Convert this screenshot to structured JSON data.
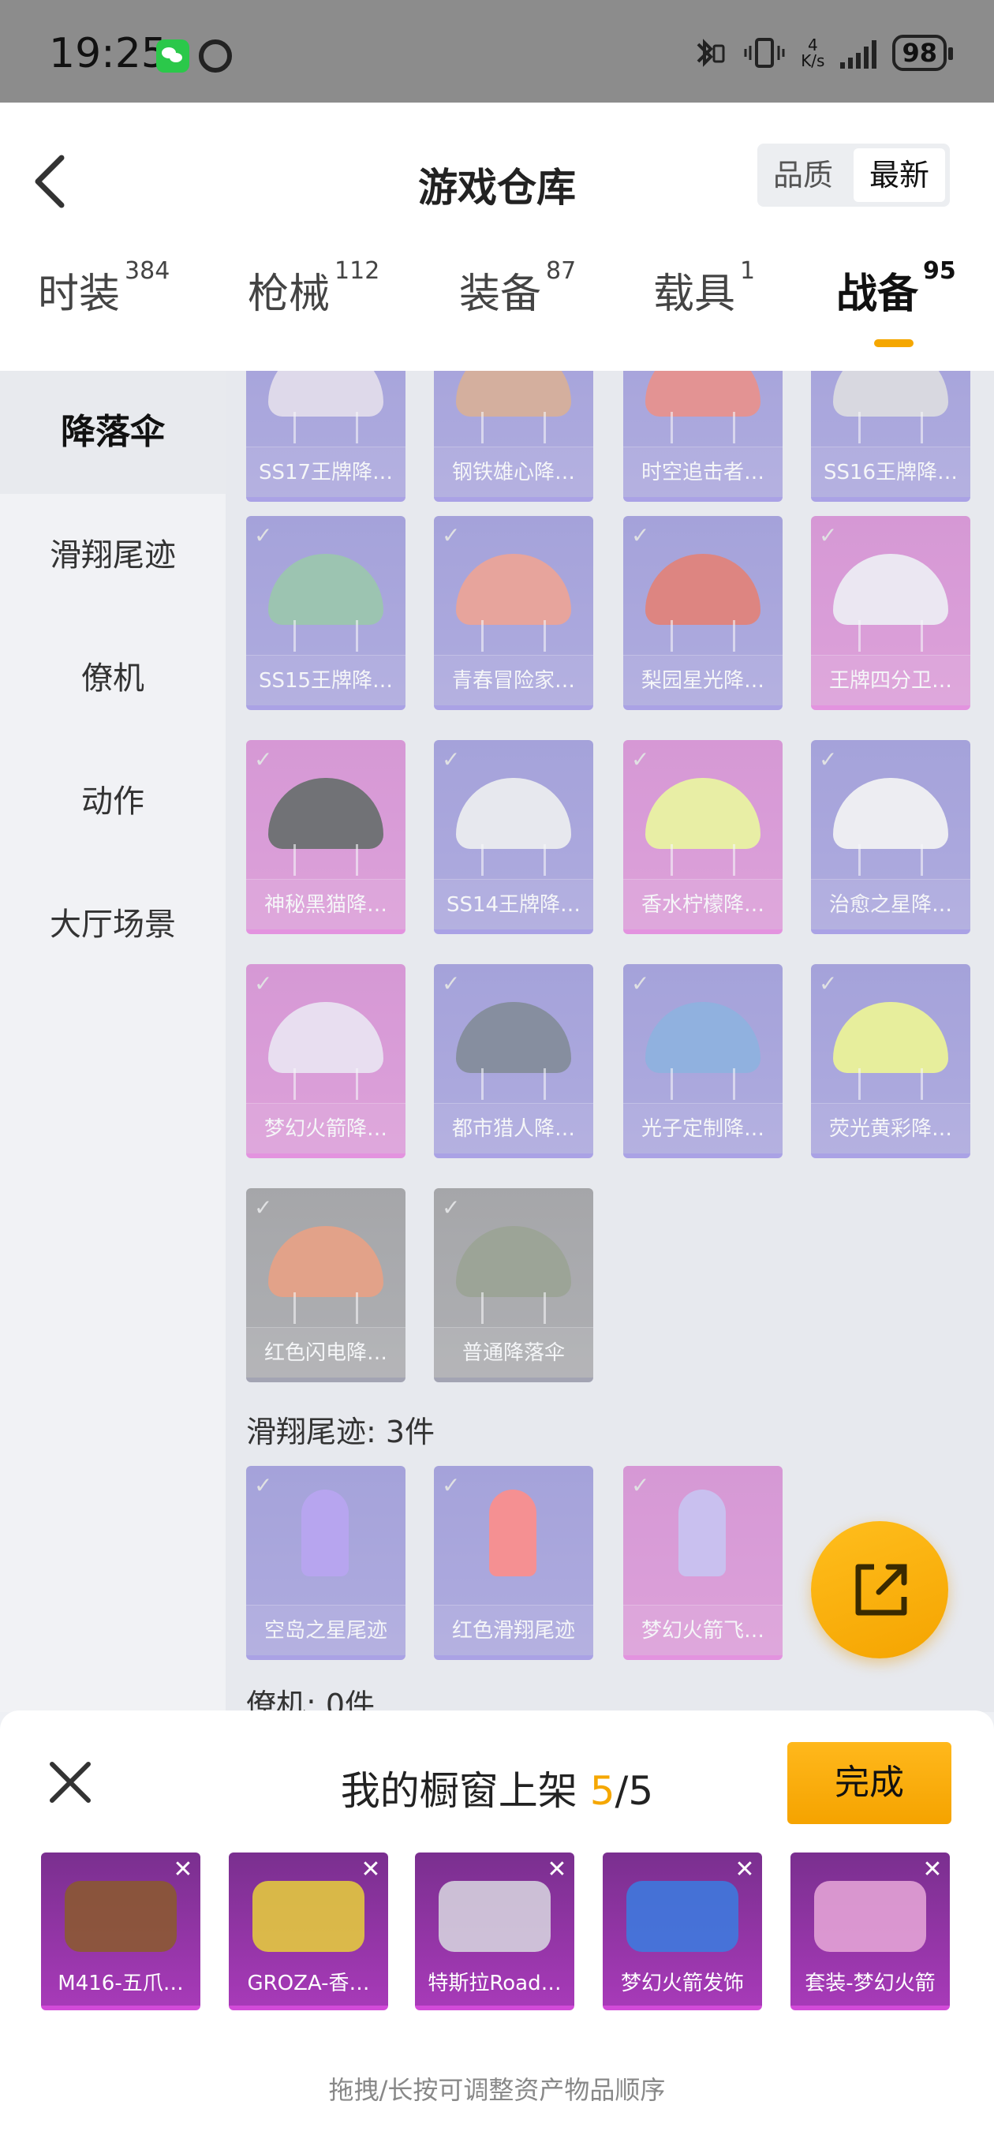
{
  "status_bar": {
    "time": "19:25",
    "net_speed_value": "4",
    "net_speed_unit": "K/s",
    "battery": "98",
    "icons": [
      "wechat-icon",
      "alarm-icon",
      "bluetooth-icon",
      "vibrate-icon",
      "signal-icon",
      "battery-icon"
    ]
  },
  "header": {
    "title": "游戏仓库",
    "sort_options": [
      "品质",
      "最新"
    ],
    "sort_selected": "最新"
  },
  "tabs": [
    {
      "label": "时装",
      "count": "384"
    },
    {
      "label": "枪械",
      "count": "112"
    },
    {
      "label": "装备",
      "count": "87"
    },
    {
      "label": "载具",
      "count": "1"
    },
    {
      "label": "战备",
      "count": "95",
      "active": true
    }
  ],
  "sidebar": {
    "items": [
      "降落伞",
      "滑翔尾迹",
      "僚机",
      "动作",
      "大厅场景"
    ],
    "active": "降落伞"
  },
  "parachutes": [
    {
      "name": "SS17王牌降…",
      "rarity": "purple",
      "color": "#d9d0e8"
    },
    {
      "name": "钢铁雄心降…",
      "rarity": "purple",
      "color": "#c98d6e"
    },
    {
      "name": "时空追击者…",
      "rarity": "purple",
      "color": "#e2605d"
    },
    {
      "name": "SS16王牌降…",
      "rarity": "purple",
      "color": "#cfcfd8"
    },
    {
      "name": "SS15王牌降…",
      "rarity": "purple",
      "color": "#6fae8c"
    },
    {
      "name": "青春冒险家…",
      "rarity": "purple",
      "color": "#e77a6a"
    },
    {
      "name": "梨园星光降…",
      "rarity": "purple",
      "color": "#d7493f"
    },
    {
      "name": "王牌四分卫…",
      "rarity": "pink",
      "color": "#eee6f5"
    },
    {
      "name": "神秘黑猫降…",
      "rarity": "pink",
      "color": "#2a2a2e"
    },
    {
      "name": "SS14王牌降…",
      "rarity": "purple",
      "color": "#e8e8ee"
    },
    {
      "name": "香水柠檬降…",
      "rarity": "pink",
      "color": "#e9f27a"
    },
    {
      "name": "治愈之星降…",
      "rarity": "purple",
      "color": "#f2f0f5"
    },
    {
      "name": "梦幻火箭降…",
      "rarity": "pink",
      "color": "#e9d8f2"
    },
    {
      "name": "都市猎人降…",
      "rarity": "purple",
      "color": "#4b5870"
    },
    {
      "name": "光子定制降…",
      "rarity": "purple",
      "color": "#5b8fd6"
    },
    {
      "name": "荧光黄彩降…",
      "rarity": "purple",
      "color": "#e8f26a"
    },
    {
      "name": "红色闪电降…",
      "rarity": "gray",
      "color": "#e0784c"
    },
    {
      "name": "普通降落伞",
      "rarity": "gray",
      "color": "#6f7a62"
    }
  ],
  "trails_section": {
    "label": "滑翔尾迹: 3件",
    "items": [
      {
        "name": "空岛之星尾迹",
        "rarity": "purple",
        "color": "#9a7df0"
      },
      {
        "name": "红色滑翔尾迹",
        "rarity": "purple",
        "color": "#ff5a5a"
      },
      {
        "name": "梦幻火箭飞…",
        "rarity": "pink",
        "color": "#b8a8f0"
      }
    ]
  },
  "wingman_section": {
    "label": "僚机: 0件"
  },
  "fab": {
    "icon": "share-export-icon"
  },
  "showcase": {
    "title_prefix": "我的橱窗上架 ",
    "count_current": "5",
    "count_total": "/5",
    "done_label": "完成",
    "items": [
      "M416-五爪…",
      "GROZA-香…",
      "特斯拉Road…",
      "梦幻火箭发饰",
      "套装-梦幻火箭"
    ],
    "remove_symbol": "✕",
    "hint": "拖拽/长按可调整资产物品顺序"
  },
  "colors": {
    "accent": "#f5a700",
    "rarity_purple": "#8577e0",
    "rarity_pink": "#e25fd7",
    "rarity_gray": "#7b7b90"
  }
}
